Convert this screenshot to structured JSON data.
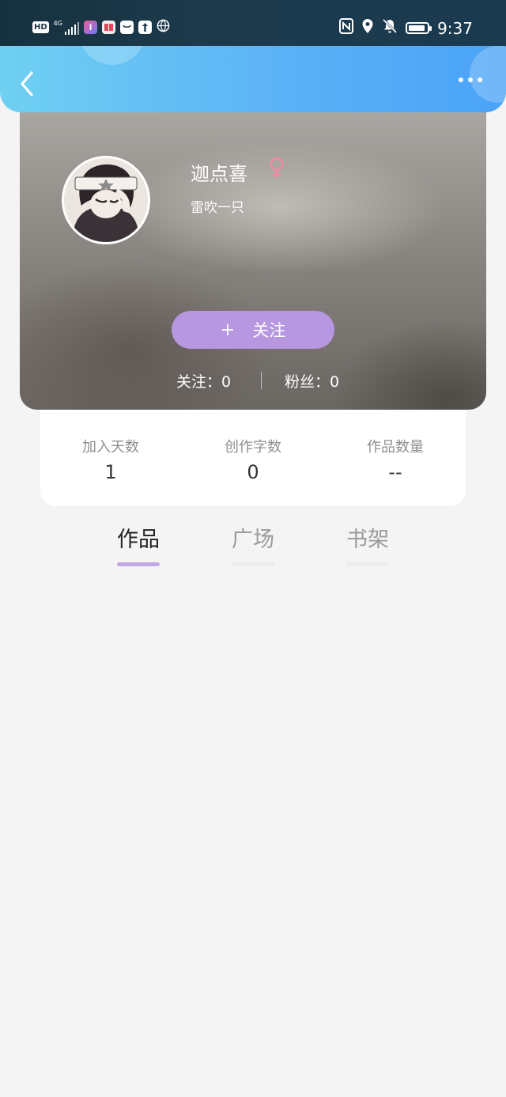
{
  "status_bar": {
    "hd": "HD",
    "network": "4G",
    "time": "9:37"
  },
  "header": {
    "back_icon": "chevron-left-icon",
    "more_icon": "more-dots-icon"
  },
  "profile": {
    "name": "迦点喜",
    "gender_symbol": "♀",
    "bio": "雷吹一只",
    "follow_button": {
      "icon": "+",
      "label": "关注"
    },
    "following": "关注：0",
    "fans": "粉丝：0"
  },
  "stats": [
    {
      "label": "加入天数",
      "value": "1"
    },
    {
      "label": "创作字数",
      "value": "0"
    },
    {
      "label": "作品数量",
      "value": "--"
    }
  ],
  "tabs": [
    {
      "label": "作品",
      "active": true
    },
    {
      "label": "广场",
      "active": false
    },
    {
      "label": "书架",
      "active": false
    }
  ],
  "colors": {
    "header_start": "#6fd0f2",
    "header_end": "#4aa3f7",
    "follow_button": "#b797e0",
    "tab_indicator": "#c3a6e4",
    "gender": "#f08aa4"
  }
}
